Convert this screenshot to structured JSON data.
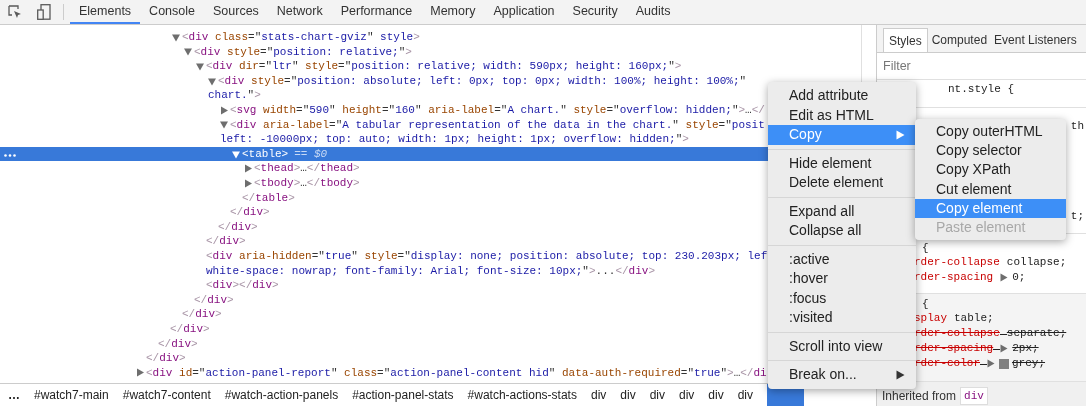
{
  "toolbar": {
    "tabs": [
      {
        "label": "Elements",
        "selected": true
      },
      {
        "label": "Console",
        "selected": false
      },
      {
        "label": "Sources",
        "selected": false
      },
      {
        "label": "Network",
        "selected": false
      },
      {
        "label": "Performance",
        "selected": false
      },
      {
        "label": "Memory",
        "selected": false
      },
      {
        "label": "Application",
        "selected": false
      },
      {
        "label": "Security",
        "selected": false
      },
      {
        "label": "Audits",
        "selected": false
      }
    ]
  },
  "dom_tree": [
    {
      "children": [
        {
          "children": [
            {
              "children": [
                {
                  "open": [
                    "<div class=\"stats-chart-gviz\" style>"
                  ],
                  "expanded": true,
                  "children": [
                    {
                      "open": [
                        "<div style=\"position: relative;\">"
                      ],
                      "expanded": true,
                      "children": [
                        {
                          "open": [
                            "<div dir=\"ltr\" style=\"position: relative; width: 590px; height: 160px;\">"
                          ],
                          "expanded": true,
                          "children": [
                            {
                              "open": [
                                "<div style=\"position: absolute; left: 0px; top: 0px; width: 100%; height: 100%;\"",
                                "chart.\">"
                              ],
                              "expanded": true,
                              "children": [
                                {
                                  "open": [
                                    "<svg width=\"590\" height=\"160\" aria-label=\"A chart.\" style=\"overflow: hidden;\">…</"
                                  ],
                                  "expanded": false
                                },
                                {
                                  "open": [
                                    "<div aria-label=\"A tabular representation of the data in the chart.\" style=\"posit",
                                    "left: -10000px; top: auto; width: 1px; height: 1px; overflow: hidden;\">"
                                  ],
                                  "expanded": true,
                                  "children": [
                                    {
                                      "open": [
                                        "<table>"
                                      ],
                                      "selected": true,
                                      "console_ref": "== $0",
                                      "expanded": true,
                                      "children": [
                                        {
                                          "open": [
                                            "<thead>…</thead>"
                                          ],
                                          "expanded": false
                                        },
                                        {
                                          "open": [
                                            "<tbody>…</tbody>"
                                          ],
                                          "expanded": false
                                        }
                                      ],
                                      "close": "</table>"
                                    }
                                  ],
                                  "close": "</div>"
                                }
                              ],
                              "close": "</div>"
                            }
                          ],
                          "close": "</div>"
                        },
                        {
                          "open": [
                            "<div aria-hidden=\"true\" style=\"display: none; position: absolute; top: 230.203px; lef",
                            "white-space: nowrap; font-family: Arial; font-size: 10px;\">...</div>"
                          ]
                        },
                        {
                          "open": [
                            "<div></div>"
                          ]
                        }
                      ],
                      "close": "</div>"
                    }
                  ],
                  "close": "</div>"
                }
              ],
              "close": "</div>"
            }
          ],
          "close": "</div>"
        }
      ],
      "close": "</div>"
    },
    {
      "open": [
        "<div id=\"action-panel-report\" class=\"action-panel-content hid\" data-auth-required=\"true\">…</di"
      ],
      "expanded": false
    }
  ],
  "breadcrumbs": [
    {
      "label": "…",
      "selected": false
    },
    {
      "label": "#watch7-main",
      "selected": false
    },
    {
      "label": "#watch7-content",
      "selected": false
    },
    {
      "label": "#watch-action-panels",
      "selected": false
    },
    {
      "label": "#action-panel-stats",
      "selected": false
    },
    {
      "label": "#watch-actions-stats",
      "selected": false
    },
    {
      "label": "div",
      "selected": false
    },
    {
      "label": "div",
      "selected": false
    },
    {
      "label": "div",
      "selected": false
    },
    {
      "label": "div",
      "selected": false
    },
    {
      "label": "div",
      "selected": false
    },
    {
      "label": "div",
      "selected": false
    },
    {
      "selected": true
    }
  ],
  "sidebar": {
    "tabs": [
      {
        "label": "Styles",
        "selected": true
      },
      {
        "label": "Computed",
        "selected": false
      },
      {
        "label": "Event Listeners",
        "selected": false
      }
    ],
    "filter": {
      "placeholder": "Filter"
    },
    "sections": [
      {
        "lines": [
          {
            "kind": "selector",
            "text": "nt.style {"
          }
        ]
      },
      {
        "lines": [
          {
            "kind": "tail",
            "text": "th"
          },
          {
            "kind": "tail",
            "text": "t;"
          }
        ]
      },
      {
        "lines": [
          {
            "kind": "brace",
            "text": "{"
          },
          {
            "kind": "decl",
            "prop": "rder-collapse",
            "value": "collapse;"
          },
          {
            "kind": "decl",
            "prop": "rder-spacing",
            "value": "0;",
            "expandable": true
          }
        ]
      },
      {
        "shaded": true,
        "lines": [
          {
            "kind": "brace",
            "text": "{"
          },
          {
            "kind": "decl",
            "prop": "splay",
            "value": "table;"
          },
          {
            "kind": "decl",
            "prop": "rder-collapse",
            "value": "separate;",
            "struck": true
          },
          {
            "kind": "decl",
            "prop": "rder-spacing",
            "value": "2px;",
            "expandable": true,
            "struck": true
          },
          {
            "kind": "decl",
            "prop": "rder-color",
            "value": "grey;",
            "expandable": true,
            "struck": true,
            "color": "#808080"
          }
        ]
      }
    ],
    "inherited": {
      "label": "Inherited from",
      "element": "div"
    }
  },
  "context_menu": {
    "groups": [
      [
        {
          "label": "Add attribute",
          "selected": false
        },
        {
          "label": "Edit as HTML",
          "selected": false
        },
        {
          "label": "Copy",
          "selected": true,
          "submenu": true
        }
      ],
      [
        {
          "label": "Hide element",
          "selected": false
        },
        {
          "label": "Delete element",
          "selected": false
        }
      ],
      [
        {
          "label": "Expand all",
          "selected": false
        },
        {
          "label": "Collapse all",
          "selected": false
        }
      ],
      [
        {
          "label": ":active",
          "selected": false
        },
        {
          "label": ":hover",
          "selected": false
        },
        {
          "label": ":focus",
          "selected": false
        },
        {
          "label": ":visited",
          "selected": false
        }
      ],
      [
        {
          "label": "Scroll into view",
          "selected": false
        }
      ],
      [
        {
          "label": "Break on...",
          "selected": false,
          "submenu": true
        }
      ]
    ]
  },
  "submenu": {
    "items": [
      {
        "label": "Copy outerHTML",
        "selected": false,
        "disabled": false
      },
      {
        "label": "Copy selector",
        "selected": false,
        "disabled": false
      },
      {
        "label": "Copy XPath",
        "selected": false,
        "disabled": false
      },
      {
        "label": "Cut element",
        "selected": false,
        "disabled": false
      },
      {
        "label": "Copy element",
        "selected": true,
        "disabled": false
      },
      {
        "label": "Paste element",
        "selected": false,
        "disabled": true
      }
    ]
  }
}
